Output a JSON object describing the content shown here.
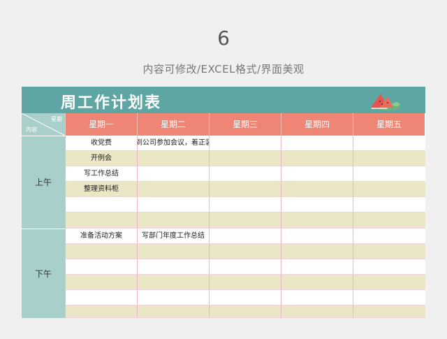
{
  "page": {
    "number": "6",
    "subtitle": "内容可修改/EXCEL格式/界面美观"
  },
  "sheet": {
    "title": "周工作计划表",
    "corner_top": "星期",
    "corner_bottom": "内容",
    "days": [
      "星期一",
      "星期二",
      "星期三",
      "星期四",
      "星期五"
    ],
    "periods": [
      {
        "label": "上午",
        "rows": [
          [
            "收党费",
            "到公司参加会议，着正装",
            "",
            "",
            ""
          ],
          [
            "开例会",
            "",
            "",
            "",
            ""
          ],
          [
            "写工作总结",
            "",
            "",
            "",
            ""
          ],
          [
            "整理资料柜",
            "",
            "",
            "",
            ""
          ],
          [
            "",
            "",
            "",
            "",
            ""
          ],
          [
            "",
            "",
            "",
            "",
            ""
          ]
        ]
      },
      {
        "label": "下午",
        "rows": [
          [
            "准备活动方案",
            "写部门年度工作总结",
            "",
            "",
            ""
          ],
          [
            "",
            "",
            "",
            "",
            ""
          ],
          [
            "",
            "",
            "",
            "",
            ""
          ],
          [
            "",
            "",
            "",
            "",
            ""
          ],
          [
            "",
            "",
            "",
            "",
            ""
          ],
          [
            "",
            "",
            "",
            "",
            ""
          ]
        ]
      }
    ]
  },
  "colors": {
    "title_bar": "#5ea6a4",
    "header_day": "#ef8575",
    "period_col": "#a8cfc9",
    "row_alt": "#ebe6c6"
  }
}
